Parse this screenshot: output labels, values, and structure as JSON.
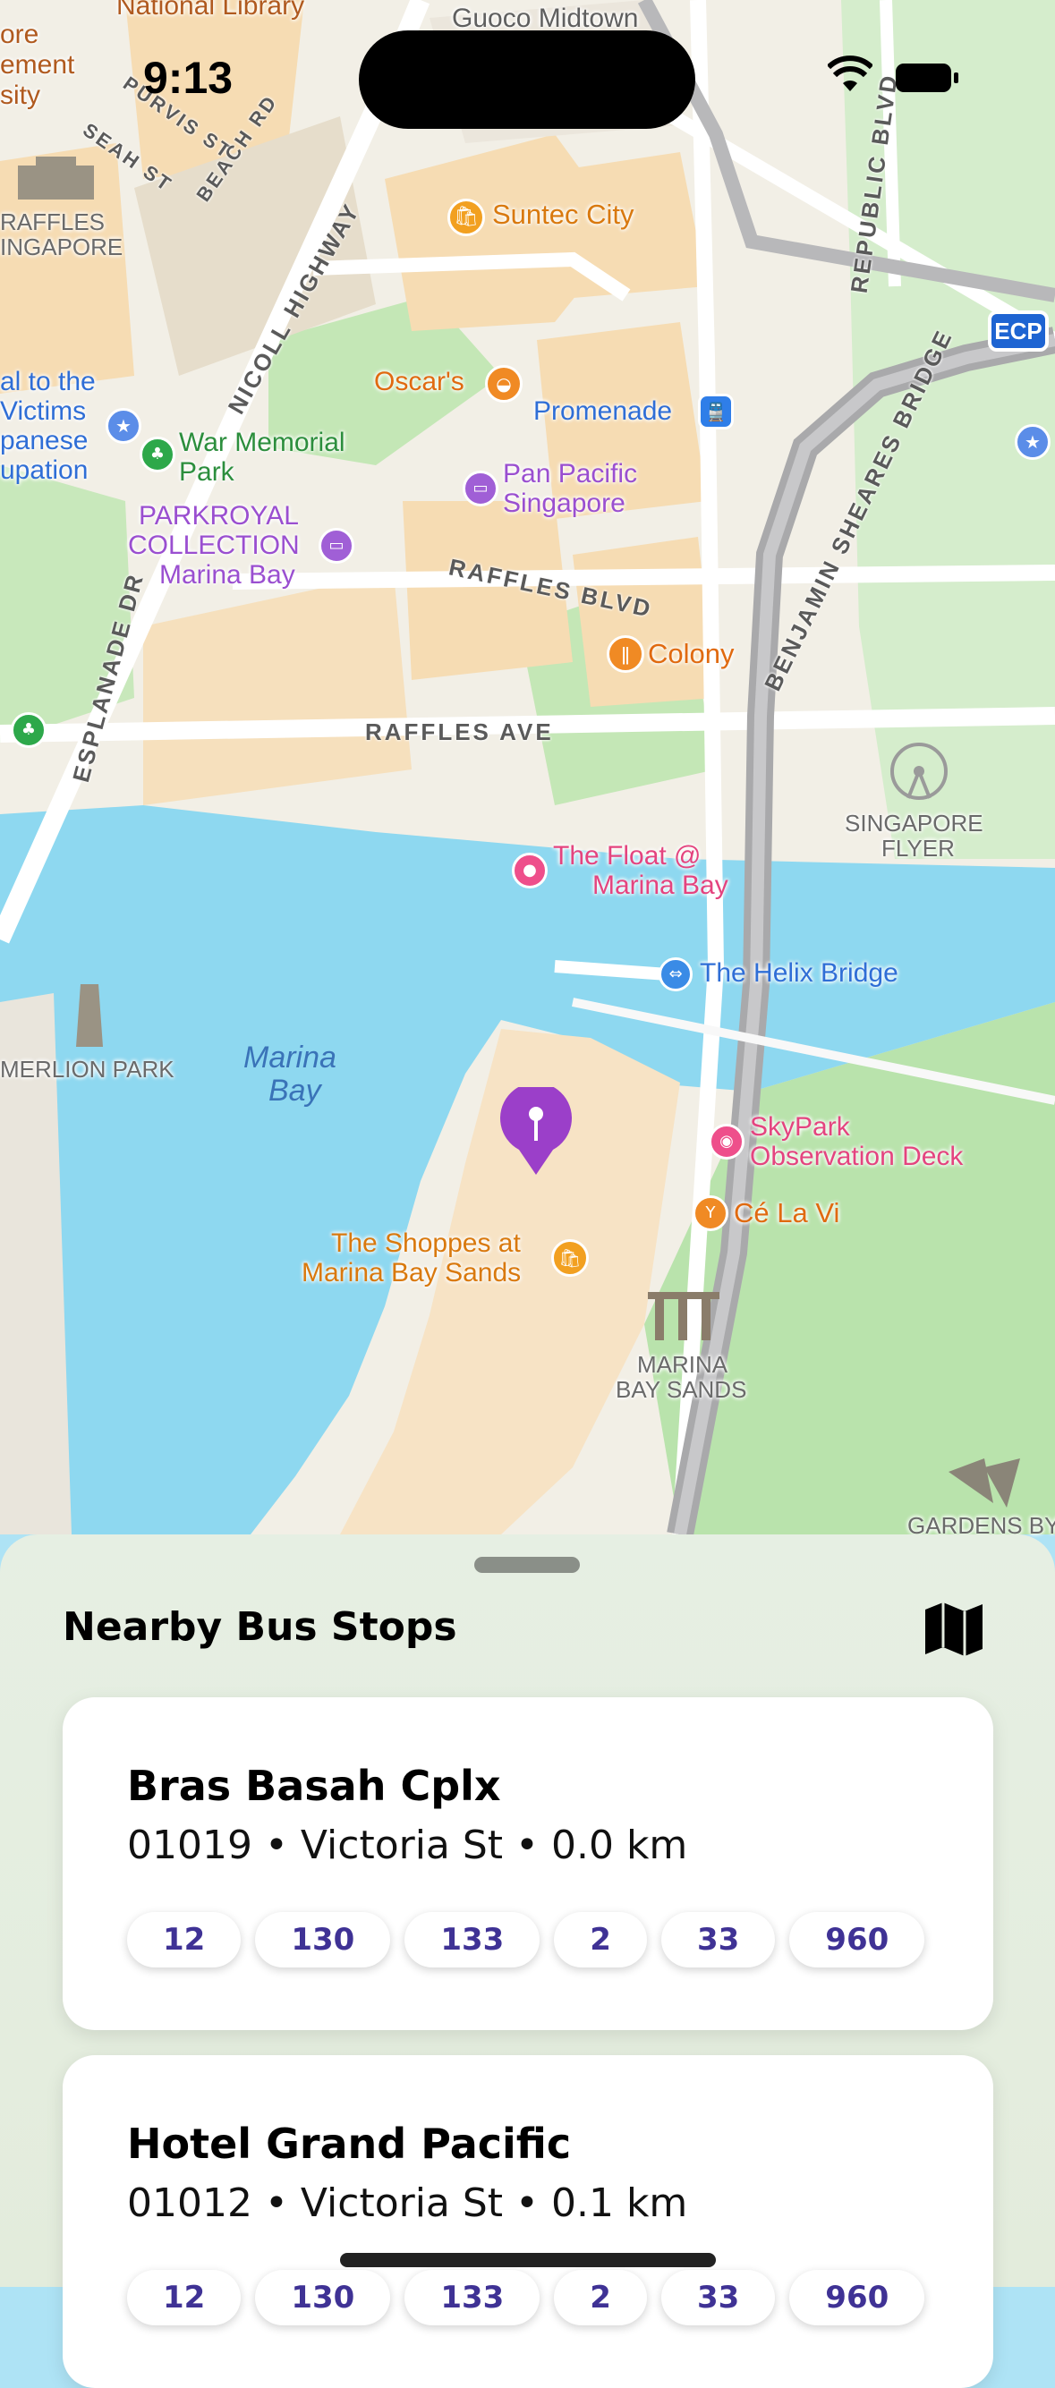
{
  "status_bar": {
    "time": "9:13"
  },
  "map": {
    "badge": "ECP",
    "places": {
      "national_library": "National Library",
      "guoco_midtown": "Guoco Midtown",
      "management_university_1": "ore",
      "management_university_2": "ement",
      "management_university_3": "sity",
      "raffles_singapore_1": "RAFFLES",
      "raffles_singapore_2": "INGAPORE",
      "suntec_city": "Suntec City",
      "oscars": "Oscar's",
      "promenade": "Promenade",
      "civilian_war_1": "al to the",
      "civilian_war_2": "Victims",
      "civilian_war_3": "panese",
      "civilian_war_4": "upation",
      "war_memorial_1": "War Memorial",
      "war_memorial_2": "Park",
      "pan_pacific_1": "Pan Pacific",
      "pan_pacific_2": "Singapore",
      "parkroyal_1": "PARKROYAL",
      "parkroyal_2": "COLLECTION",
      "parkroyal_3": "Marina Bay",
      "colony": "Colony",
      "singapore_flyer_1": "SINGAPORE",
      "singapore_flyer_2": "FLYER",
      "the_float_1": "The Float @",
      "the_float_2": "Marina Bay",
      "helix_bridge": "The Helix Bridge",
      "merlion_park": "MERLION PARK",
      "marina_bay_1": "Marina",
      "marina_bay_2": "Bay",
      "skypark_1": "SkyPark",
      "skypark_2": "Observation Deck",
      "ce_la_vi": "Cé La Vi",
      "shoppes_1": "The Shoppes at",
      "shoppes_2": "Marina Bay Sands",
      "mbs_1": "MARINA",
      "mbs_2": "BAY SANDS",
      "gardens": "GARDENS BY"
    },
    "roads": {
      "purvis_st": "PURVIS ST",
      "seah_st": "SEAH ST",
      "beach_rd": "BEACH RD",
      "nicoll_highway": "NICOLL HIGHWAY",
      "republic_blvd": "REPUBLIC BLVD",
      "benjamin_sheares": "BENJAMIN SHEARES BRIDGE",
      "raffles_blvd": "RAFFLES BLVD",
      "raffles_ave": "RAFFLES AVE",
      "esplanade_dr": "ESPLANADE DR"
    }
  },
  "sheet": {
    "title": "Nearby Bus Stops",
    "stops": [
      {
        "name": "Bras Basah Cplx",
        "info": "01019 • Victoria St • 0.0 km",
        "services": [
          "12",
          "130",
          "133",
          "2",
          "33",
          "960"
        ]
      },
      {
        "name": "Hotel Grand Pacific",
        "info": "01012 • Victoria St • 0.1 km",
        "services": [
          "12",
          "130",
          "133",
          "2",
          "33",
          "960"
        ]
      }
    ]
  },
  "colors": {
    "land": "#f2efe6",
    "water": "#8ed8f0",
    "park": "#bfe6b1",
    "building": "#f6dcb3",
    "expressway": "#a9a9ab",
    "accent_purple": "#3f3295",
    "pin": "#9b3fc9"
  }
}
